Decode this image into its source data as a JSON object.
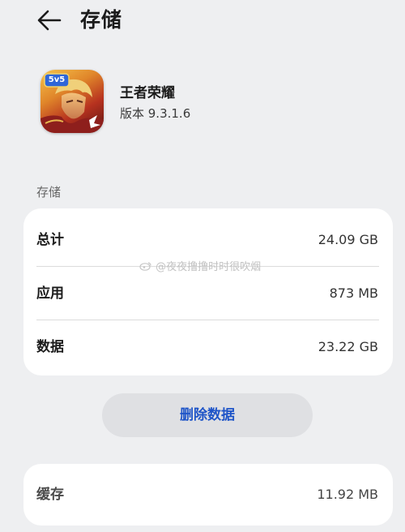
{
  "header": {
    "title": "存储",
    "back_icon": "arrow-left-icon"
  },
  "app": {
    "name": "王者荣耀",
    "version": "版本 9.3.1.6",
    "icon_badge": "5v5",
    "icon": "game-app-icon"
  },
  "storage": {
    "section_label": "存储",
    "rows": [
      {
        "label": "总计",
        "value": "24.09 GB"
      },
      {
        "label": "应用",
        "value": "873 MB"
      },
      {
        "label": "数据",
        "value": "23.22 GB"
      }
    ]
  },
  "actions": {
    "clear_data": "删除数据"
  },
  "cache": {
    "label": "缓存",
    "value": "11.92 MB"
  },
  "watermark": "@夜夜撸撸时时很吹烟",
  "colors": {
    "background": "#eeeff1",
    "card": "#ffffff",
    "accent": "#1f55c8",
    "button_bg": "#dfe0e3"
  }
}
